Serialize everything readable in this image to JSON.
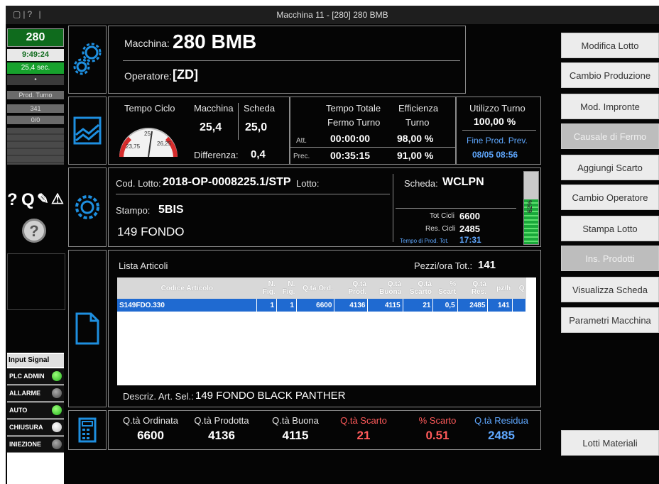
{
  "window": {
    "title": "Macchina 11 - [280] 280 BMB",
    "left_icons": "▢|?   |"
  },
  "left": {
    "machine_num": "280",
    "time": "9:49:24",
    "cycle": "25,4 sec.",
    "dot": "•",
    "prod_turno_label": "Prod. Turno",
    "prod_turno_val": "341",
    "ratio": "0/0",
    "signals_title": "Input Signal",
    "signals": [
      {
        "label": "PLC ADMIN",
        "state": "green"
      },
      {
        "label": "ALLARME",
        "state": "off"
      },
      {
        "label": "AUTO",
        "state": "green"
      },
      {
        "label": "CHIUSURA",
        "state": "white"
      },
      {
        "label": "INIEZIONE",
        "state": "off"
      }
    ]
  },
  "header": {
    "macchina_label": "Macchina:",
    "macchina_val": "280 BMB",
    "operatore_label": "Operatore:",
    "operatore_val": "[ZD]"
  },
  "cycle": {
    "tempo_ciclo_label": "Tempo Ciclo",
    "gauge_low": "23,75",
    "gauge_mid": "25",
    "gauge_high": "26,25",
    "macchina_label": "Macchina",
    "scheda_label": "Scheda",
    "macchina_val": "25,4",
    "scheda_val": "25,0",
    "differenza_label": "Differenza:",
    "differenza_val": "0,4",
    "att_label": "Att.",
    "prec_label": "Prec.",
    "tempo_totale_label": "Tempo Totale",
    "fermo_turno_label": "Fermo Turno",
    "fermo_att": "00:00:00",
    "fermo_prec": "00:35:15",
    "efficienza_label": "Efficienza",
    "turno_label": "Turno",
    "eff_att": "98,00 %",
    "eff_prec": "91,00 %",
    "utilizzo_label": "Utilizzo Turno",
    "utilizzo_val": "100,00 %",
    "fine_prod_label": "Fine Prod. Prev.",
    "fine_prod_val": "08/05 08:56"
  },
  "lotto": {
    "cod_label": "Cod. Lotto:",
    "cod_val": "2018-OP-0008225.1/STP",
    "lotto_suffix": "Lotto:",
    "stampo_label": "Stampo:",
    "stampo_val": "5BIS",
    "fondo": "149 FONDO",
    "scheda_label": "Scheda:",
    "scheda_val": "WCLPN",
    "tot_cicli_label": "Tot Cicli",
    "tot_cicli_val": "6600",
    "res_cicli_label": "Res. Cicli",
    "res_cicli_val": "2485",
    "tempo_prod_label": "Tempo di Prod. Tot.",
    "tempo_prod_val": "17:31",
    "bar_label": "62%",
    "bar_fill_pct": 62
  },
  "articoli": {
    "title": "Lista Articoli",
    "pezzi_label": "Pezzi/ora Tot.:",
    "pezzi_val": "141",
    "columns": [
      "Codice Articolo",
      "N. Fig.",
      "N. Fig.",
      "Q.tà Ord.",
      "Q.tà Prod.",
      "Q.tà Buona",
      "Q.tà Scarto",
      "% Scart",
      "Q.tà Res.",
      "pz/h",
      "Q"
    ],
    "rows": [
      [
        "S149FDO.330",
        "1",
        "1",
        "6600",
        "4136",
        "4115",
        "21",
        "0,5",
        "2485",
        "141",
        ""
      ]
    ],
    "descr_label": "Descriz. Art. Sel.:",
    "descr_val": "149 FONDO BLACK PANTHER"
  },
  "totals": [
    {
      "label": "Q.tà Ordinata",
      "value": "6600",
      "color": "#ffffff"
    },
    {
      "label": "Q.tà Prodotta",
      "value": "4136",
      "color": "#ffffff"
    },
    {
      "label": "Q.tà Buona",
      "value": "4115",
      "color": "#ffffff"
    },
    {
      "label": "Q.tà Scarto",
      "value": "21",
      "color": "#ff5a5a"
    },
    {
      "label": "% Scarto",
      "value": "0.51",
      "color": "#ff5a5a"
    },
    {
      "label": "Q.tà Residua",
      "value": "2485",
      "color": "#5fa8ff"
    }
  ],
  "right_buttons": [
    {
      "label": "Modifica Lotto",
      "enabled": true
    },
    {
      "label": "Cambio Produzione",
      "enabled": true
    },
    {
      "label": "Mod. Impronte",
      "enabled": true
    },
    {
      "label": "Causale di Fermo",
      "enabled": false
    },
    {
      "label": "Aggiungi Scarto",
      "enabled": true
    },
    {
      "label": "Cambio Operatore",
      "enabled": true
    },
    {
      "label": "Stampa Lotto",
      "enabled": true
    },
    {
      "label": "Ins. Prodotti",
      "enabled": false
    },
    {
      "label": "Visualizza Scheda",
      "enabled": true
    },
    {
      "label": "Parametri Macchina",
      "enabled": true
    },
    {
      "label": "Lotti Materiali",
      "enabled": true
    }
  ]
}
